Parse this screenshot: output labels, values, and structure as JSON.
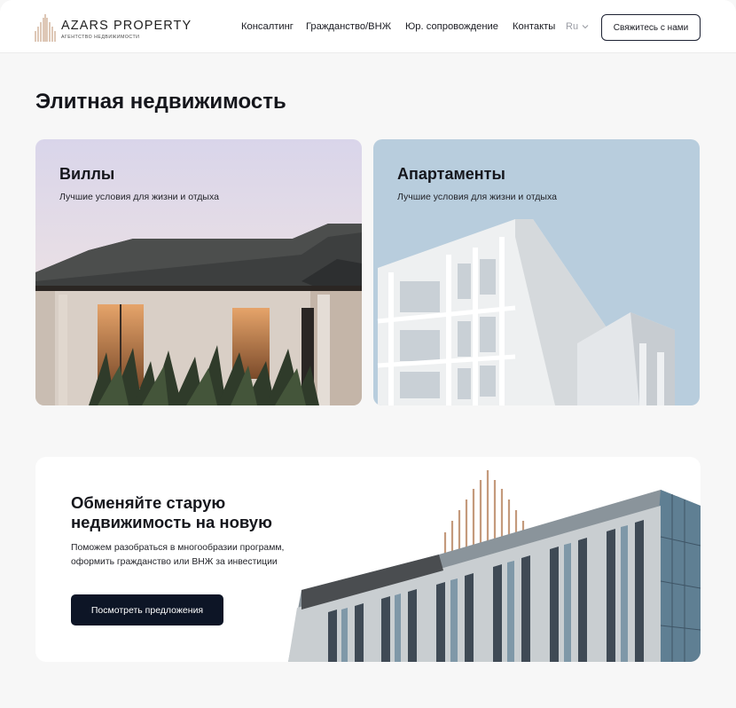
{
  "brand": {
    "name": "AZARS PROPERTY",
    "tagline": "АГЕНТСТВО НЕДВИЖИМОСТИ"
  },
  "nav": {
    "items": [
      {
        "label": "Консалтинг"
      },
      {
        "label": "Гражданство/ВНЖ"
      },
      {
        "label": "Юр. сопровождение"
      },
      {
        "label": "Контакты"
      }
    ],
    "language": "Ru",
    "contact_button": "Свяжитесь с нами"
  },
  "page_title": "Элитная недвижимость",
  "cards": [
    {
      "title": "Виллы",
      "subtitle": "Лучшие условия для жизни и отдыха"
    },
    {
      "title": "Апартаменты",
      "subtitle": "Лучшие условия для жизни и отдыха"
    }
  ],
  "promo": {
    "title": "Обменяйте старую недвижимость на новую",
    "text": "Поможем разобраться в многообразии программ, оформить гражданство или ВНЖ за инвестиции",
    "button": "Посмотреть предложения"
  },
  "colors": {
    "accent_dark": "#0d1526",
    "logo_copper": "#c49a7c",
    "background": "#f7f7f7"
  },
  "icons": {
    "language_dropdown": "chevron-down-icon",
    "logo_mark": "logo-icon"
  }
}
